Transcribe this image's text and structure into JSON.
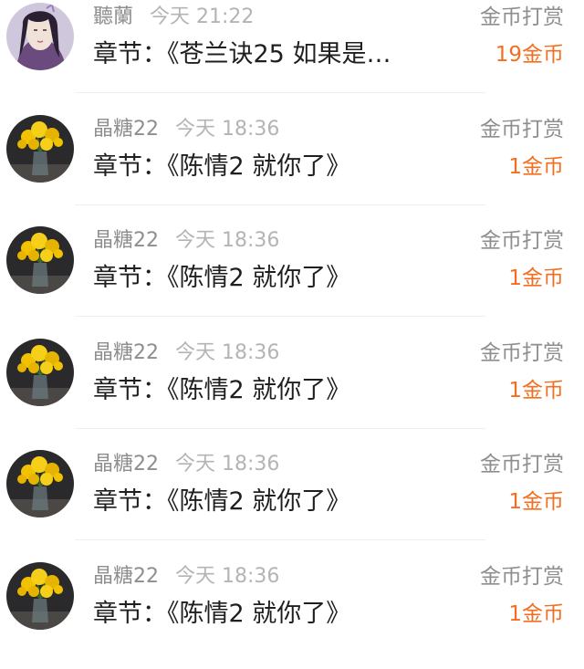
{
  "rewards": [
    {
      "user": "聽蘭",
      "time": "今天 21:22",
      "chapter": "章节：《苍兰诀25  如果是…",
      "type": "金币打赏",
      "amount": "19金币",
      "avatar": "character-portrait"
    },
    {
      "user": "晶糖22",
      "time": "今天 18:36",
      "chapter": "章节：《陈情2  就你了》",
      "type": "金币打赏",
      "amount": "1金币",
      "avatar": "yellow-flowers"
    },
    {
      "user": "晶糖22",
      "time": "今天 18:36",
      "chapter": "章节：《陈情2  就你了》",
      "type": "金币打赏",
      "amount": "1金币",
      "avatar": "yellow-flowers"
    },
    {
      "user": "晶糖22",
      "time": "今天 18:36",
      "chapter": "章节：《陈情2  就你了》",
      "type": "金币打赏",
      "amount": "1金币",
      "avatar": "yellow-flowers"
    },
    {
      "user": "晶糖22",
      "time": "今天 18:36",
      "chapter": "章节：《陈情2  就你了》",
      "type": "金币打赏",
      "amount": "1金币",
      "avatar": "yellow-flowers"
    },
    {
      "user": "晶糖22",
      "time": "今天 18:36",
      "chapter": "章节：《陈情2  就你了》",
      "type": "金币打赏",
      "amount": "1金币",
      "avatar": "yellow-flowers"
    }
  ],
  "colors": {
    "accent": "#f26f21",
    "muted": "#8e8e8e",
    "text": "#1f1f1f"
  }
}
